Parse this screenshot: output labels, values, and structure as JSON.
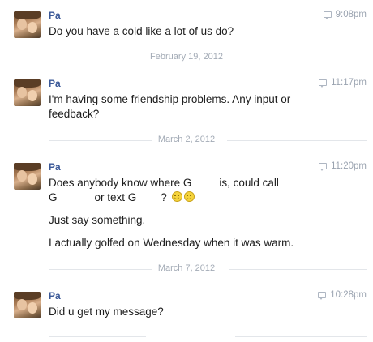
{
  "messages": [
    {
      "sender": "Pa",
      "time": "9:08pm",
      "lines": [
        "Do you have a cold like a lot of us do?"
      ]
    },
    {
      "sender": "Pa",
      "time": "11:17pm",
      "lines": [
        "I'm having some friendship problems. Any input or",
        "feedback?"
      ]
    },
    {
      "sender": "Pa",
      "time": "11:20pm",
      "line1_a": "Does anybody know where G",
      "line1_b": "is, could call",
      "line2_a": "G",
      "line2_b": "or text G",
      "line2_c": "?",
      "para2": "Just say something.",
      "para3": "I actually golfed on Wednesday when it was warm."
    },
    {
      "sender": "Pa",
      "time": "10:28pm",
      "lines": [
        "Did u get my message?"
      ]
    }
  ],
  "dividers": [
    "February 19, 2012",
    "March 2, 2012",
    "March 7, 2012"
  ],
  "icons": {
    "time": "chat-bubble-icon",
    "emoji": "smiley-icon"
  }
}
